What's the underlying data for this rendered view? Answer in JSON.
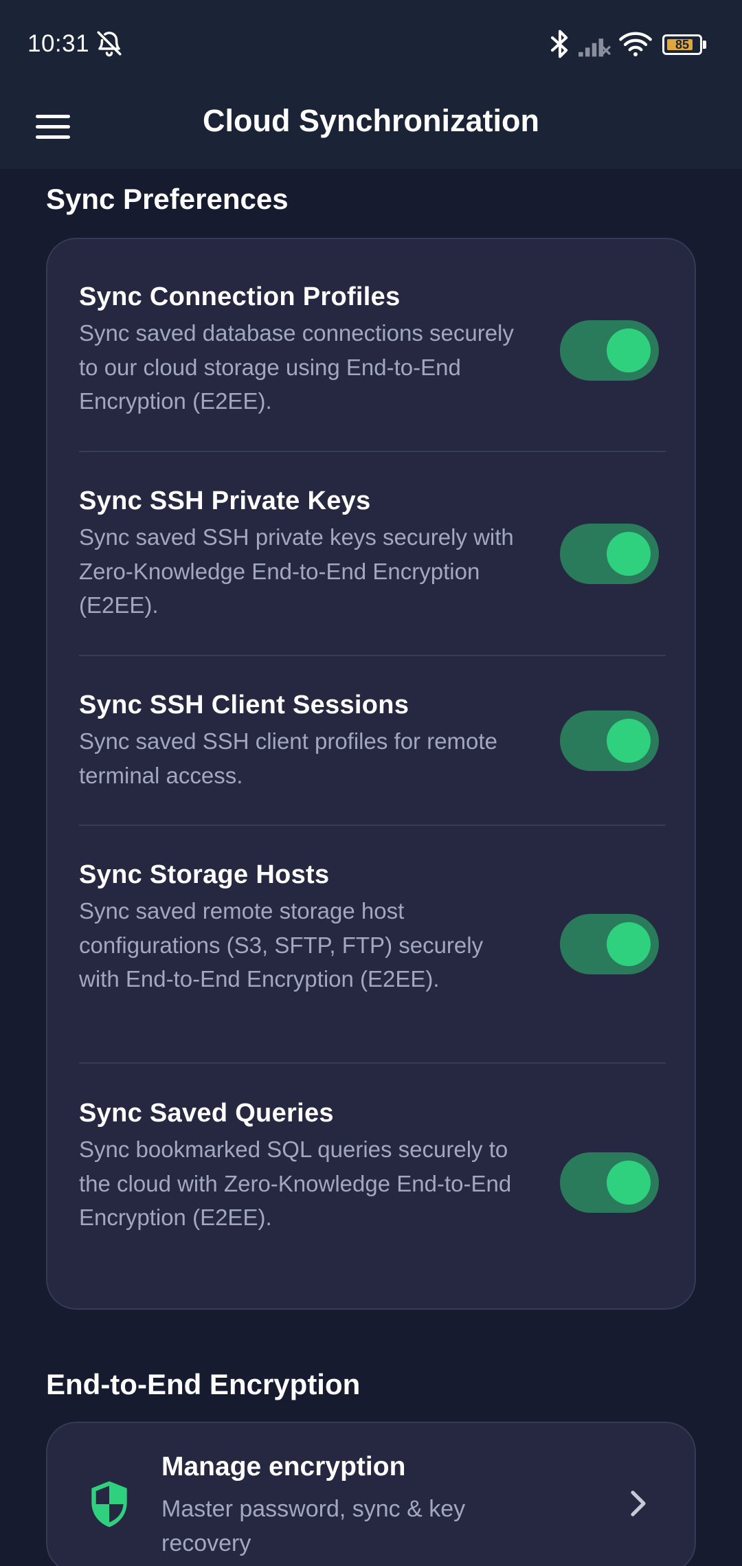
{
  "status_bar": {
    "time": "10:31",
    "battery_level": "85",
    "battery_fraction": 0.85,
    "icons": [
      "bell-off-icon",
      "bluetooth-icon",
      "signal-icon",
      "wifi-icon",
      "battery-icon"
    ]
  },
  "app_bar": {
    "title": "Cloud Synchronization",
    "menu_icon": "hamburger-menu-icon"
  },
  "sync_section": {
    "title": "Sync Preferences",
    "items": [
      {
        "title": "Sync Connection Profiles",
        "description": "Sync saved database connections securely to our cloud storage using End-to-End Encryption (E2EE).",
        "enabled": true
      },
      {
        "title": "Sync SSH Private Keys",
        "description": "Sync saved SSH private keys securely with Zero-Knowledge End-to-End Encryption (E2EE).",
        "enabled": true
      },
      {
        "title": "Sync SSH Client Sessions",
        "description": "Sync saved SSH client profiles for remote terminal access.",
        "enabled": true
      },
      {
        "title": "Sync Storage Hosts",
        "description": "Sync saved remote storage host configurations (S3, SFTP, FTP) securely with End-to-End Encryption (E2EE).",
        "enabled": true
      },
      {
        "title": "Sync Saved Queries",
        "description": "Sync bookmarked SQL queries securely to the cloud with Zero-Knowledge End-to-End Encryption (E2EE).",
        "enabled": true
      }
    ]
  },
  "encryption_section": {
    "title": "End-to-End Encryption",
    "item": {
      "title": "Manage encryption",
      "description": "Master password, sync & key recovery",
      "icon": "shield-icon"
    }
  },
  "colors": {
    "background": "#161b30",
    "bar": "#1a2436",
    "card": "#252840",
    "accent": "#2fd07e",
    "toggle_track": "#2a7a5c"
  }
}
